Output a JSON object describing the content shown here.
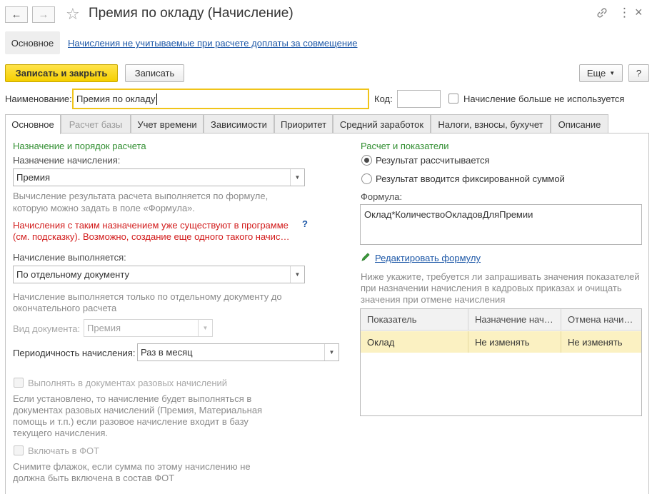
{
  "window": {
    "title": "Премия по окладу (Начисление)"
  },
  "top_tabs": {
    "main": "Основное",
    "link": "Начисления не учитываемые при расчете доплаты за совмещение"
  },
  "toolbar": {
    "save_close": "Записать и закрыть",
    "save": "Записать",
    "more": "Еще",
    "help": "?"
  },
  "header": {
    "name_label": "Наименование:",
    "name_value": "Премия по окладу",
    "code_label": "Код:",
    "code_value": "",
    "not_used_label": "Начисление больше не используется"
  },
  "tabs": [
    {
      "label": "Основное"
    },
    {
      "label": "Расчет базы"
    },
    {
      "label": "Учет времени"
    },
    {
      "label": "Зависимости"
    },
    {
      "label": "Приоритет"
    },
    {
      "label": "Средний заработок"
    },
    {
      "label": "Налоги, взносы, бухучет"
    },
    {
      "label": "Описание"
    }
  ],
  "left": {
    "section_title": "Назначение и порядок расчета",
    "purpose_label": "Назначение начисления:",
    "purpose_value": "Премия",
    "purpose_hint_1": "Вычисление результата расчета выполняется по формуле,",
    "purpose_hint_2": "которую можно задать в поле «Формула».",
    "warning_1": "Начисления с таким назначением уже существуют в программе",
    "warning_2": "(см. подсказку). Возможно, создание еще одного такого начис…",
    "warning_help": "?",
    "performed_label": "Начисление выполняется:",
    "performed_value": "По отдельному документу",
    "performed_hint_1": "Начисление выполняется только по отдельному документу до",
    "performed_hint_2": "окончательного расчета",
    "doc_type_label": "Вид документа:",
    "doc_type_value": "Премия",
    "periodicity_label": "Периодичность начисления:",
    "periodicity_value": "Раз в месяц",
    "one_time_label": "Выполнять в документах разовых начислений",
    "one_time_hint_1": "Если установлено, то начисление будет выполняться в",
    "one_time_hint_2": "документах разовых начислений (Премия, Материальная",
    "one_time_hint_3": "помощь и т.п.) если разовое начисление входит в базу",
    "one_time_hint_4": "текущего начисления.",
    "fot_label": "Включать в ФОТ",
    "fot_hint_1": "Снимите флажок, если сумма по этому начислению не",
    "fot_hint_2": "должна быть включена в состав ФОТ"
  },
  "right": {
    "section_title": "Расчет и показатели",
    "radio_calculated": "Результат рассчитывается",
    "radio_fixed": "Результат вводится фиксированной суммой",
    "formula_label": "Формула:",
    "formula_value": "Оклад*КоличествоОкладовДляПремии",
    "edit_formula": "Редактировать формулу",
    "table_hint_1": "Ниже укажите, требуется ли запрашивать значения показателей",
    "table_hint_2": "при назначении начисления в кадровых приказах и очищать",
    "table_hint_3": "значения при отмене начисления",
    "table": {
      "headers": [
        "Показатель",
        "Назначение нач…",
        "Отмена начи…"
      ],
      "rows": [
        [
          "Оклад",
          "Не изменять",
          "Не изменять"
        ]
      ]
    }
  },
  "colors": {
    "accent_yellow": "#f5cf00",
    "section_green": "#2f8d2f",
    "warning_red": "#d21b1b",
    "link_blue": "#1c57a7",
    "selected_row": "#fbf1c2"
  }
}
